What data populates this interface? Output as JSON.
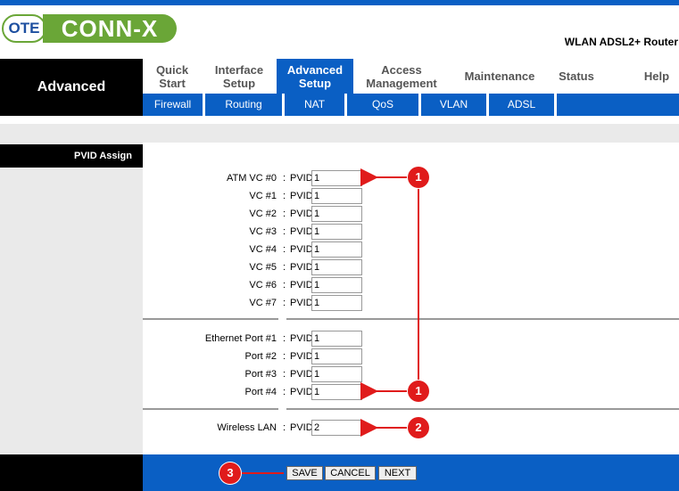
{
  "logo": {
    "ote": "OTE",
    "brand": "CONN-X"
  },
  "product": "WLAN ADSL2+ Router",
  "left_title": "Advanced",
  "nav": [
    {
      "label1": "Quick",
      "label2": "Start"
    },
    {
      "label1": "Interface",
      "label2": "Setup"
    },
    {
      "label1": "Advanced",
      "label2": "Setup"
    },
    {
      "label1": "Access",
      "label2": "Management"
    },
    {
      "label1": "Maintenance",
      "label2": ""
    },
    {
      "label1": "Status",
      "label2": ""
    },
    {
      "label1": "Help",
      "label2": ""
    }
  ],
  "subnav": [
    "Firewall",
    "Routing",
    "NAT",
    "QoS",
    "VLAN",
    "ADSL"
  ],
  "section": "PVID Assign",
  "colon": ":",
  "pvid_label": "PVID",
  "rows": [
    {
      "label": "ATM VC #0",
      "value": "1"
    },
    {
      "label": "VC #1",
      "value": "1"
    },
    {
      "label": "VC #2",
      "value": "1"
    },
    {
      "label": "VC #3",
      "value": "1"
    },
    {
      "label": "VC #4",
      "value": "1"
    },
    {
      "label": "VC #5",
      "value": "1"
    },
    {
      "label": "VC #6",
      "value": "1"
    },
    {
      "label": "VC #7",
      "value": "1"
    },
    {
      "label": "Ethernet Port #1",
      "value": "1"
    },
    {
      "label": "Port #2",
      "value": "1"
    },
    {
      "label": "Port #3",
      "value": "1"
    },
    {
      "label": "Port #4",
      "value": "1"
    },
    {
      "label": "Wireless LAN",
      "value": "2"
    }
  ],
  "buttons": {
    "save": "SAVE",
    "cancel": "CANCEL",
    "next": "NEXT"
  },
  "annotations": {
    "a1": "1",
    "a2": "1",
    "a3": "2",
    "a4": "3"
  },
  "colors": {
    "accent": "#0a5fc4",
    "brand_green": "#6aa637",
    "callout_red": "#e01b1b"
  }
}
